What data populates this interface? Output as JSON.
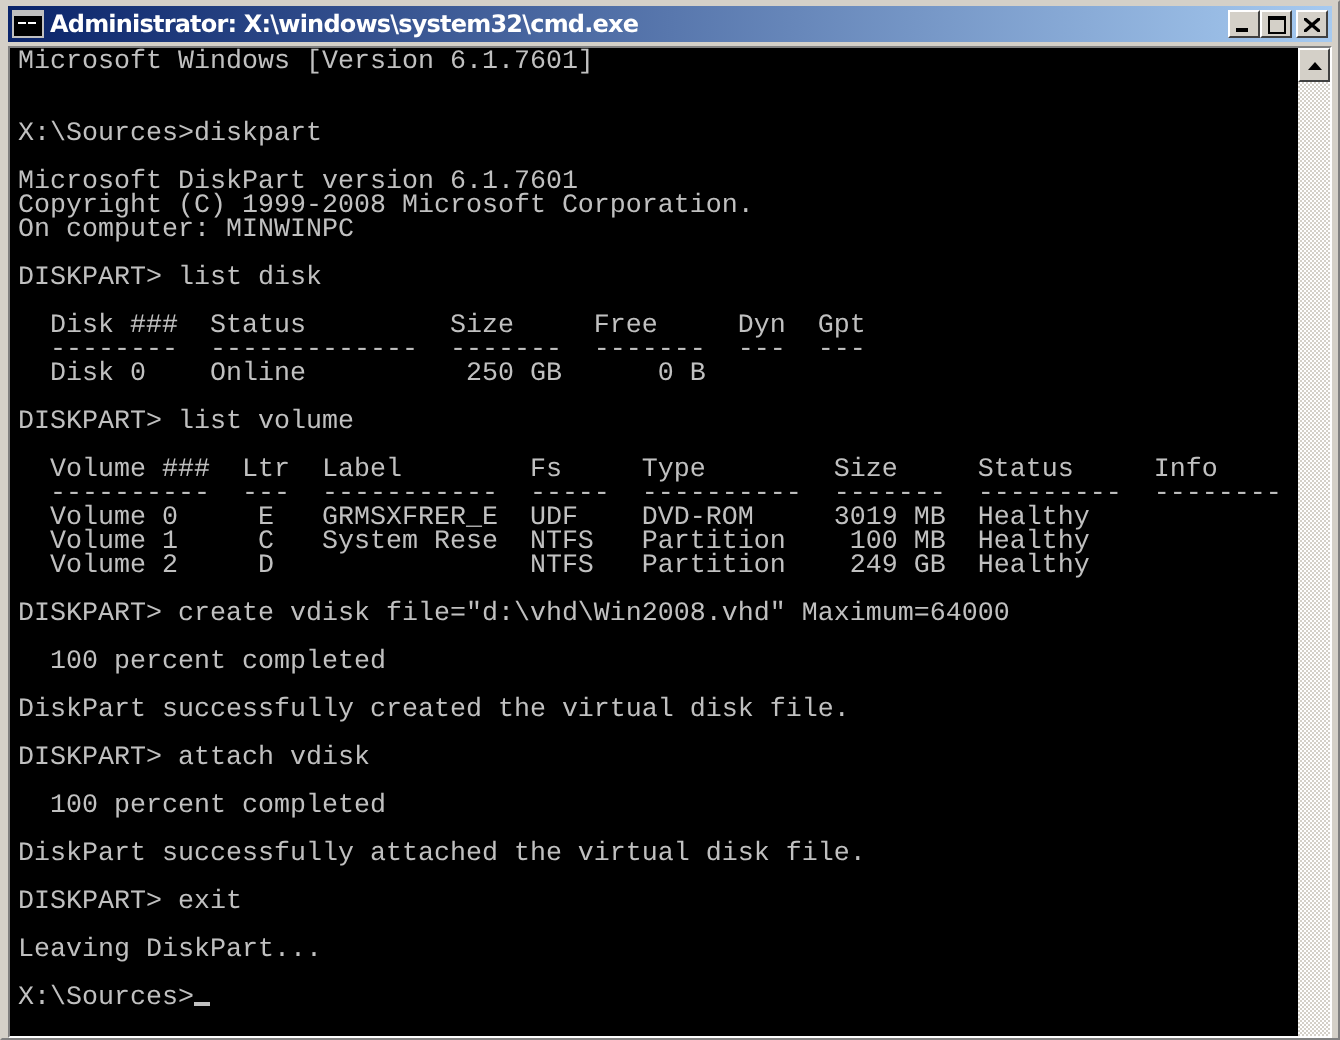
{
  "window": {
    "title": "Administrator: X:\\windows\\system32\\cmd.exe"
  },
  "console": {
    "lines": [
      {
        "kind": "text",
        "text": "Microsoft Windows [Version 6.1.7601]"
      },
      {
        "kind": "blank"
      },
      {
        "kind": "blank"
      },
      {
        "kind": "text",
        "text": "X:\\Sources>diskpart"
      },
      {
        "kind": "blank"
      },
      {
        "kind": "text",
        "text": "Microsoft DiskPart version 6.1.7601"
      },
      {
        "kind": "text",
        "text": "Copyright (C) 1999-2008 Microsoft Corporation."
      },
      {
        "kind": "text",
        "text": "On computer: MINWINPC"
      },
      {
        "kind": "blank"
      },
      {
        "kind": "text",
        "text": "DISKPART> list disk"
      },
      {
        "kind": "blank"
      },
      {
        "kind": "text",
        "text": "  Disk ###  Status         Size     Free     Dyn  Gpt"
      },
      {
        "kind": "text",
        "text": "  --------  -------------  -------  -------  ---  ---"
      },
      {
        "kind": "text",
        "text": "  Disk 0    Online          250 GB      0 B"
      },
      {
        "kind": "blank"
      },
      {
        "kind": "text",
        "text": "DISKPART> list volume"
      },
      {
        "kind": "blank"
      },
      {
        "kind": "text",
        "text": "  Volume ###  Ltr  Label        Fs     Type        Size     Status     Info"
      },
      {
        "kind": "text",
        "text": "  ----------  ---  -----------  -----  ----------  -------  ---------  --------"
      },
      {
        "kind": "text",
        "text": "  Volume 0     E   GRMSXFRER_E  UDF    DVD-ROM     3019 MB  Healthy"
      },
      {
        "kind": "text",
        "text": "  Volume 1     C   System Rese  NTFS   Partition    100 MB  Healthy"
      },
      {
        "kind": "text",
        "text": "  Volume 2     D                NTFS   Partition    249 GB  Healthy"
      },
      {
        "kind": "blank"
      },
      {
        "kind": "text",
        "text": "DISKPART> create vdisk file=\"d:\\vhd\\Win2008.vhd\" Maximum=64000"
      },
      {
        "kind": "blank"
      },
      {
        "kind": "text",
        "text": "  100 percent completed"
      },
      {
        "kind": "blank"
      },
      {
        "kind": "text",
        "text": "DiskPart successfully created the virtual disk file."
      },
      {
        "kind": "blank"
      },
      {
        "kind": "text",
        "text": "DISKPART> attach vdisk"
      },
      {
        "kind": "blank"
      },
      {
        "kind": "text",
        "text": "  100 percent completed"
      },
      {
        "kind": "blank"
      },
      {
        "kind": "text",
        "text": "DiskPart successfully attached the virtual disk file."
      },
      {
        "kind": "blank"
      },
      {
        "kind": "text",
        "text": "DISKPART> exit"
      },
      {
        "kind": "blank"
      },
      {
        "kind": "text",
        "text": "Leaving DiskPart..."
      },
      {
        "kind": "blank"
      },
      {
        "kind": "prompt",
        "text": "X:\\Sources>"
      }
    ]
  }
}
